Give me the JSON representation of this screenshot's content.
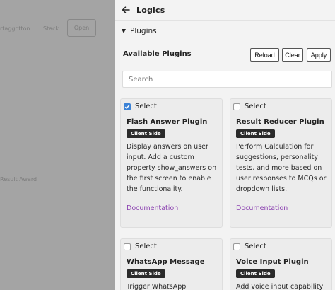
{
  "background": {
    "items": [
      {
        "text": "rtaggotton"
      },
      {
        "text": "Stack"
      },
      {
        "text": "Open"
      },
      {
        "text": "Result Award"
      }
    ]
  },
  "panel": {
    "title": "Logics",
    "section_label": "Plugins",
    "available_label": "Available Plugins",
    "buttons": {
      "reload": "Reload",
      "clear": "Clear",
      "apply": "Apply"
    },
    "search_placeholder": "Search",
    "plugins": [
      {
        "select_label": "Select",
        "selected": true,
        "name": "Flash Answer Plugin",
        "badge": "Client Side",
        "description": [
          "Display answers on user",
          "input. Add a custom",
          "property show_answers on",
          "the first screen to enable",
          "the functionality."
        ],
        "link": "Documentation"
      },
      {
        "select_label": "Select",
        "selected": false,
        "name": "Result Reducer Plugin",
        "badge": "Client Side",
        "description": [
          "Perform Calculation for",
          "suggestions, personality",
          "tests, and more based on",
          "user responses to MCQs or",
          "dropdown lists."
        ],
        "link": "Documentation"
      },
      {
        "select_label": "Select",
        "selected": false,
        "name": "WhatsApp Message",
        "badge": "Client Side",
        "description": [
          "Trigger WhatsApp"
        ]
      },
      {
        "select_label": "Select",
        "selected": false,
        "name": "Voice Input Plugin",
        "badge": "Client Side",
        "description": [
          "Add voice input capability"
        ]
      }
    ]
  },
  "colors": {
    "accent_checkbox": "#3b82d6",
    "link": "#8a3fb0",
    "badge_bg": "#2b2b2b"
  }
}
